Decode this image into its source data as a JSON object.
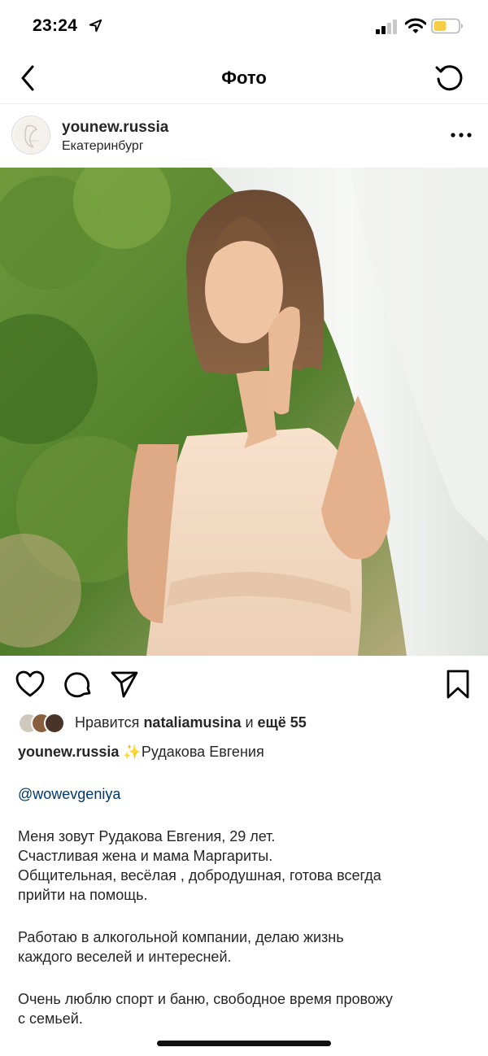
{
  "status_bar": {
    "time": "23:24"
  },
  "nav": {
    "title": "Фото"
  },
  "post": {
    "username": "younew.russia",
    "location": "Екатеринбург"
  },
  "likes": {
    "prefix": "Нравится ",
    "user": "nataliamusina",
    "middle": " и ",
    "count": "ещё 55"
  },
  "caption": {
    "username": "younew.russia",
    "sparkle": "✨",
    "headline": "Рудакова Евгения",
    "mention": "@wowevgeniya",
    "para1": [
      "Меня зовут Рудакова Евгения, 29 лет.",
      "Счастливая жена и мама Маргариты.",
      "Общительная, весёлая , добродушная, готова всегда",
      "прийти на помощь."
    ],
    "para2": [
      "Работаю в алкогольной компании, делаю жизнь",
      "каждого веселей и интересней."
    ],
    "para3": [
      "Очень люблю спорт и баню, свободное время провожу",
      "с семьей."
    ]
  },
  "icons": {
    "back": "chevron-left-icon",
    "refresh": "refresh-icon",
    "more": "more-horizontal-icon",
    "like": "heart-icon",
    "comment": "comment-icon",
    "share": "send-icon",
    "save": "bookmark-icon"
  },
  "colors": {
    "text": "#262626",
    "mention": "#00376b",
    "battery": "#f7cf46",
    "divider": "#ececec"
  }
}
